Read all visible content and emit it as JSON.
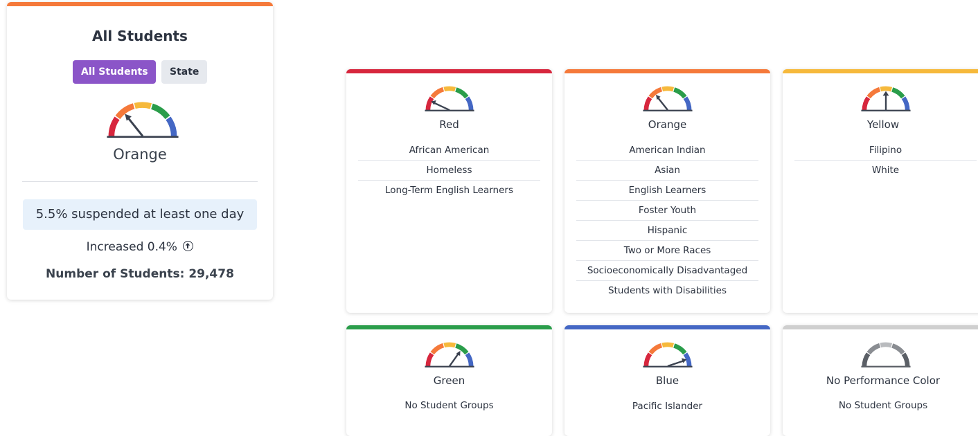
{
  "colors": {
    "red": "#d7263d",
    "orange": "#f5793a",
    "yellow": "#f6b93b",
    "green": "#2a9d4a",
    "blue": "#4467c4",
    "gray": "#cfcfcf",
    "needle": "#3b4250",
    "purple": "#8b55c8"
  },
  "summary": {
    "title": "All Students",
    "buttons": [
      "All Students",
      "State"
    ],
    "color_label": "Orange",
    "rate_text": "5.5% suspended at least one day",
    "change_text": "Increased 0.4%",
    "change_icon": "circle-arrow-up-icon",
    "count_text": "Number of Students: 29,478"
  },
  "groups": {
    "red": {
      "title": "Red",
      "items": [
        "African American",
        "Homeless",
        "Long-Term English Learners"
      ]
    },
    "orange": {
      "title": "Orange",
      "items": [
        "American Indian",
        "Asian",
        "English Learners",
        "Foster Youth",
        "Hispanic",
        "Two or More Races",
        "Socioeconomically Disadvantaged",
        "Students with Disabilities"
      ]
    },
    "yellow": {
      "title": "Yellow",
      "items": [
        "Filipino",
        "White"
      ]
    },
    "green": {
      "title": "Green",
      "empty_text": "No Student Groups"
    },
    "blue": {
      "title": "Blue",
      "items": [
        "Pacific Islander"
      ]
    },
    "none": {
      "title": "No Performance Color",
      "empty_text": "No Student Groups"
    }
  }
}
